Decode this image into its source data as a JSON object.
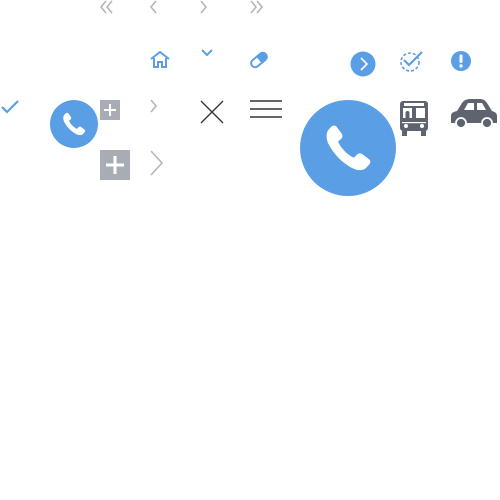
{
  "colors": {
    "blue": "#5a9fe5",
    "gray_light": "#b3b6ba",
    "gray_box": "#a8adb5",
    "dark": "#333333",
    "vehicle": "#5d6470",
    "white": "#ffffff"
  },
  "icons": [
    {
      "name": "double-chevron-left-icon",
      "interactable": true
    },
    {
      "name": "chevron-left-icon",
      "interactable": true
    },
    {
      "name": "chevron-right-icon",
      "interactable": true
    },
    {
      "name": "double-chevron-right-icon",
      "interactable": true
    },
    {
      "name": "home-icon",
      "interactable": true
    },
    {
      "name": "chevron-down-icon",
      "interactable": true
    },
    {
      "name": "pill-icon",
      "interactable": true
    },
    {
      "name": "circle-arrow-right-icon",
      "interactable": true
    },
    {
      "name": "dashed-check-circle-icon",
      "interactable": true
    },
    {
      "name": "alert-circle-icon",
      "interactable": true
    },
    {
      "name": "check-icon",
      "interactable": true
    },
    {
      "name": "phone-call-icon",
      "interactable": true
    },
    {
      "name": "plus-box-icon",
      "interactable": true
    },
    {
      "name": "chevron-right-icon",
      "interactable": true
    },
    {
      "name": "close-icon",
      "interactable": true
    },
    {
      "name": "menu-icon",
      "interactable": true
    },
    {
      "name": "phone-call-icon",
      "interactable": true
    },
    {
      "name": "bus-icon",
      "interactable": false
    },
    {
      "name": "car-icon",
      "interactable": false
    },
    {
      "name": "plus-box-icon",
      "interactable": true
    },
    {
      "name": "chevron-right-icon",
      "interactable": true
    }
  ]
}
